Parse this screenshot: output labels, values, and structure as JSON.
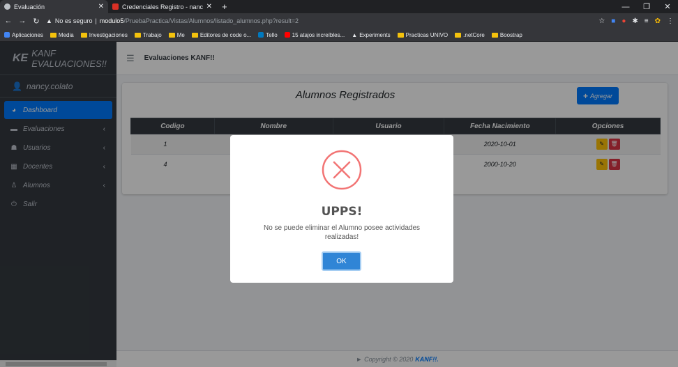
{
  "browser": {
    "tabs": [
      {
        "title": "Evaluación",
        "active": true
      },
      {
        "title": "Credenciales Registro - nancycol",
        "active": false
      }
    ],
    "new_tab": "+",
    "address": {
      "security": "No es seguro",
      "host": "modulo5",
      "path": "/PruebaPractica/Vistas/Alumnos/listado_alumnos.php?result=2"
    },
    "bookmarks": [
      {
        "label": "Aplicaciones",
        "icon": "apps-icon"
      },
      {
        "label": "Media",
        "icon": "folder-icon"
      },
      {
        "label": "Investigaciones",
        "icon": "folder-icon"
      },
      {
        "label": "Trabajo",
        "icon": "folder-icon"
      },
      {
        "label": "Me",
        "icon": "folder-icon"
      },
      {
        "label": "Editores de code o...",
        "icon": "folder-icon"
      },
      {
        "label": "Tello",
        "icon": "trello-icon"
      },
      {
        "label": "15 atajos increíbles...",
        "icon": "youtube-icon"
      },
      {
        "label": "Experiments",
        "icon": "experiments-icon"
      },
      {
        "label": "Practicas UNIVO",
        "icon": "folder-icon"
      },
      {
        "label": ".netCore",
        "icon": "folder-icon"
      },
      {
        "label": "Boostrap",
        "icon": "folder-icon"
      }
    ]
  },
  "sidebar": {
    "brand_logo": "KE",
    "brand_name": "KANF EVALUACIONES!!",
    "user": "nancy.colato",
    "items": [
      {
        "label": "Dashboard",
        "icon": "dashboard-icon",
        "active": true
      },
      {
        "label": "Evaluaciones",
        "icon": "folder-icon",
        "caret": true
      },
      {
        "label": "Usuarios",
        "icon": "users-icon",
        "caret": true
      },
      {
        "label": "Docentes",
        "icon": "building-icon",
        "caret": true
      },
      {
        "label": "Alumnos",
        "icon": "student-icon",
        "caret": true
      },
      {
        "label": "Salir",
        "icon": "power-icon"
      }
    ]
  },
  "header": {
    "title": "Evaluaciones KANF!!"
  },
  "main": {
    "card_title": "Alumnos Registrados",
    "add_button": "Agregar",
    "table": {
      "columns": [
        "Codigo",
        "Nombre",
        "Usuario",
        "Fecha Nacimiento",
        "Opciones"
      ],
      "rows": [
        {
          "codigo": "1",
          "nombre": "",
          "usuario": "",
          "fecha": "2020-10-01"
        },
        {
          "codigo": "4",
          "nombre": "",
          "usuario": "",
          "fecha": "2000-10-20"
        }
      ]
    }
  },
  "footer": {
    "text": "Copyright © 2020",
    "brand": "KANF!!."
  },
  "modal": {
    "title": "UPPS!",
    "message": "No se puede eliminar el Alumno posee actividades realizadas!",
    "ok_button": "OK",
    "icon": "error-x-icon",
    "accent": "#f27474",
    "button_color": "#3085d6"
  }
}
